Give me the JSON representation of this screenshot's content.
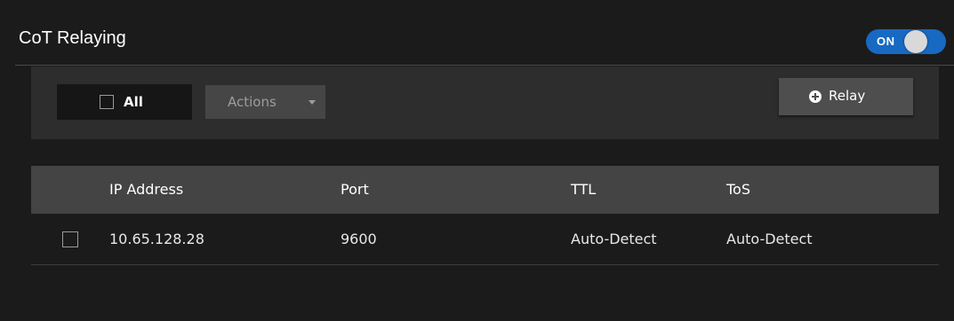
{
  "panel": {
    "title": "CoT Relaying",
    "toggle": {
      "label": "ON",
      "state": "on",
      "accent": "#1769c2"
    }
  },
  "toolbar": {
    "select_all_label": "All",
    "actions_label": "Actions",
    "relay_label": "Relay"
  },
  "table": {
    "columns": [
      "IP Address",
      "Port",
      "TTL",
      "ToS"
    ],
    "rows": [
      {
        "ip": "10.65.128.28",
        "port": "9600",
        "ttl": "Auto-Detect",
        "tos": "Auto-Detect"
      }
    ]
  }
}
